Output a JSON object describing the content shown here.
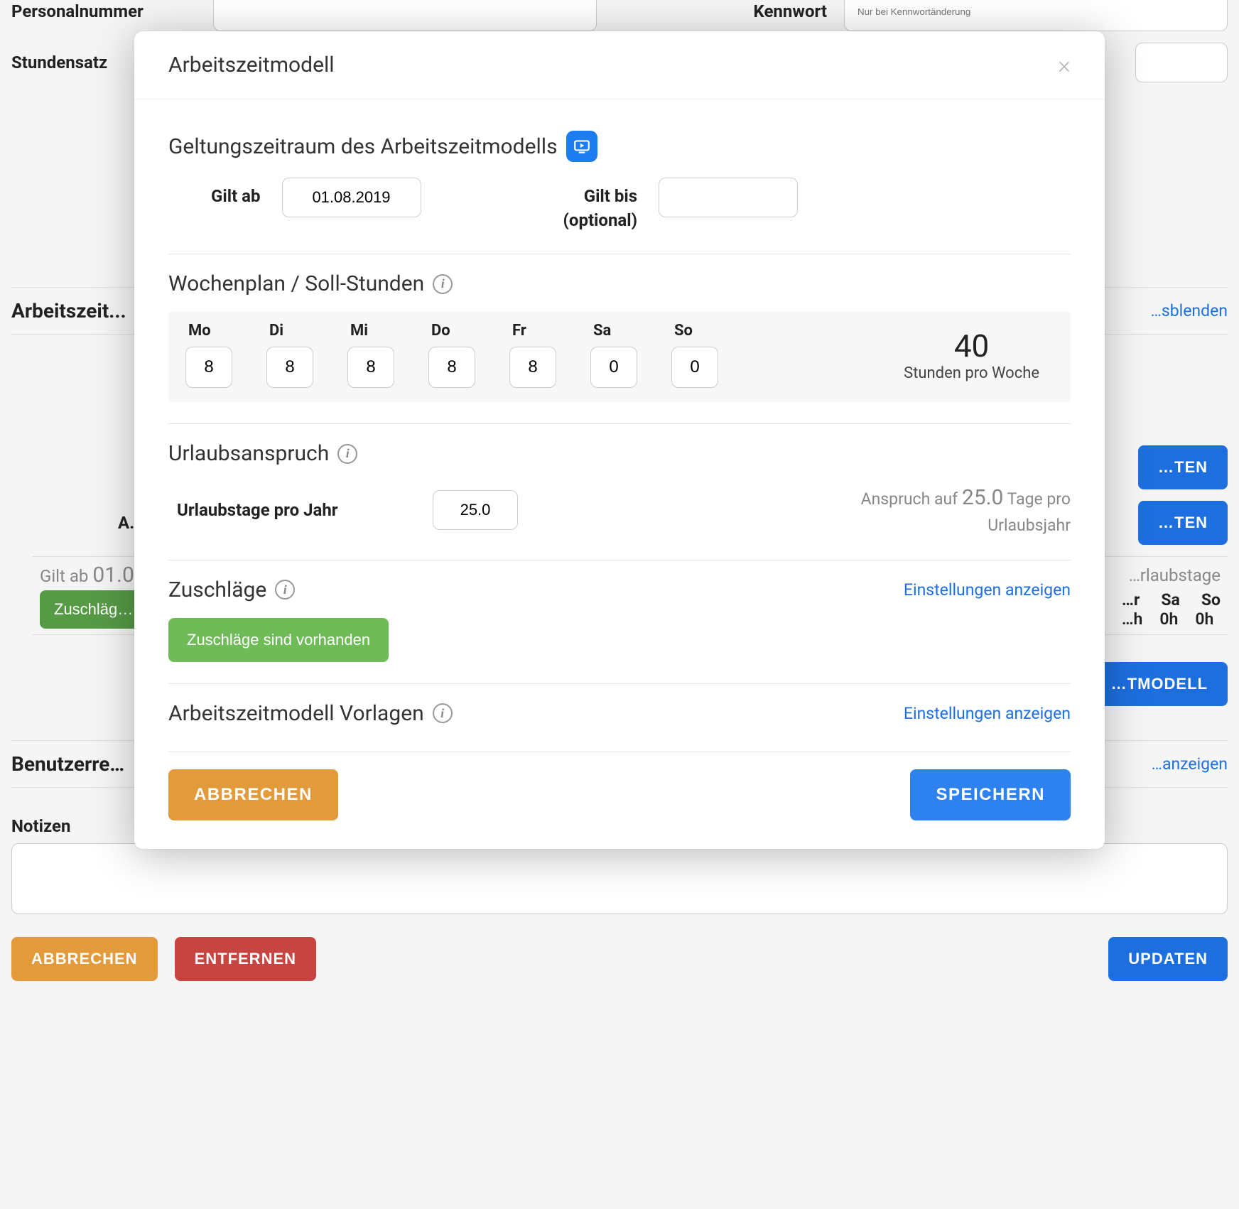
{
  "bg": {
    "personalnummer_label": "Personalnummer",
    "kennwort_label": "Kennwort",
    "kennwort_placeholder": "Nur bei Kennwortänderung",
    "stundensatz_label": "Stundensatz",
    "arbeitszeit_section": "Arbeitszeit...",
    "ausblenden_link": "…sblenden",
    "bearbeiten_btn": "…TEN",
    "bearbeiten_btn2": "…TEN",
    "a_label": "A…",
    "gilt_ab": "Gilt ab",
    "gilt_ab_date": "01.0…",
    "urlaubstage_label": "…rlaubstage",
    "days": {
      "fr": "…r",
      "sa": "Sa",
      "so": "So"
    },
    "hours": {
      "fr": "…h",
      "sa": "0h",
      "so": "0h"
    },
    "zuschlage_btn": "Zuschläg…",
    "arbeitszeitmodell_btn": "…TMODELL",
    "benutzer_section": "Benutzerre…",
    "anzeigen_link": "…anzeigen",
    "notizen_label": "Notizen",
    "abbrechen": "ABBRECHEN",
    "entfernen": "ENTFERNEN",
    "updaten": "UPDATEN"
  },
  "modal": {
    "title": "Arbeitszeitmodell",
    "geltung_title": "Geltungszeitraum des Arbeitszeitmodells",
    "gilt_ab_label": "Gilt ab",
    "gilt_ab_value": "01.08.2019",
    "gilt_bis_label": "Gilt bis",
    "gilt_bis_opt": "(optional)",
    "gilt_bis_value": "",
    "wochen_title": "Wochenplan / Soll-Stunden",
    "days": {
      "mo": {
        "label": "Mo",
        "value": "8"
      },
      "di": {
        "label": "Di",
        "value": "8"
      },
      "mi": {
        "label": "Mi",
        "value": "8"
      },
      "do": {
        "label": "Do",
        "value": "8"
      },
      "fr": {
        "label": "Fr",
        "value": "8"
      },
      "sa": {
        "label": "Sa",
        "value": "0"
      },
      "so": {
        "label": "So",
        "value": "0"
      }
    },
    "week_total": "40",
    "week_total_sub": "Stunden pro Woche",
    "urlaub_title": "Urlaubsanspruch",
    "urlaub_label": "Urlaubstage pro Jahr",
    "urlaub_value": "25.0",
    "urlaub_right_pre": "Anspruch auf ",
    "urlaub_right_num": "25.0",
    "urlaub_right_post": " Tage pro Urlaubsjahr",
    "zuschlage_title": "Zuschläge",
    "zuschlage_link": "Einstellungen anzeigen",
    "zuschlage_pill": "Zuschläge sind vorhanden",
    "vorlagen_title": "Arbeitszeitmodell Vorlagen",
    "vorlagen_link": "Einstellungen anzeigen",
    "cancel": "ABBRECHEN",
    "save": "SPEICHERN"
  }
}
